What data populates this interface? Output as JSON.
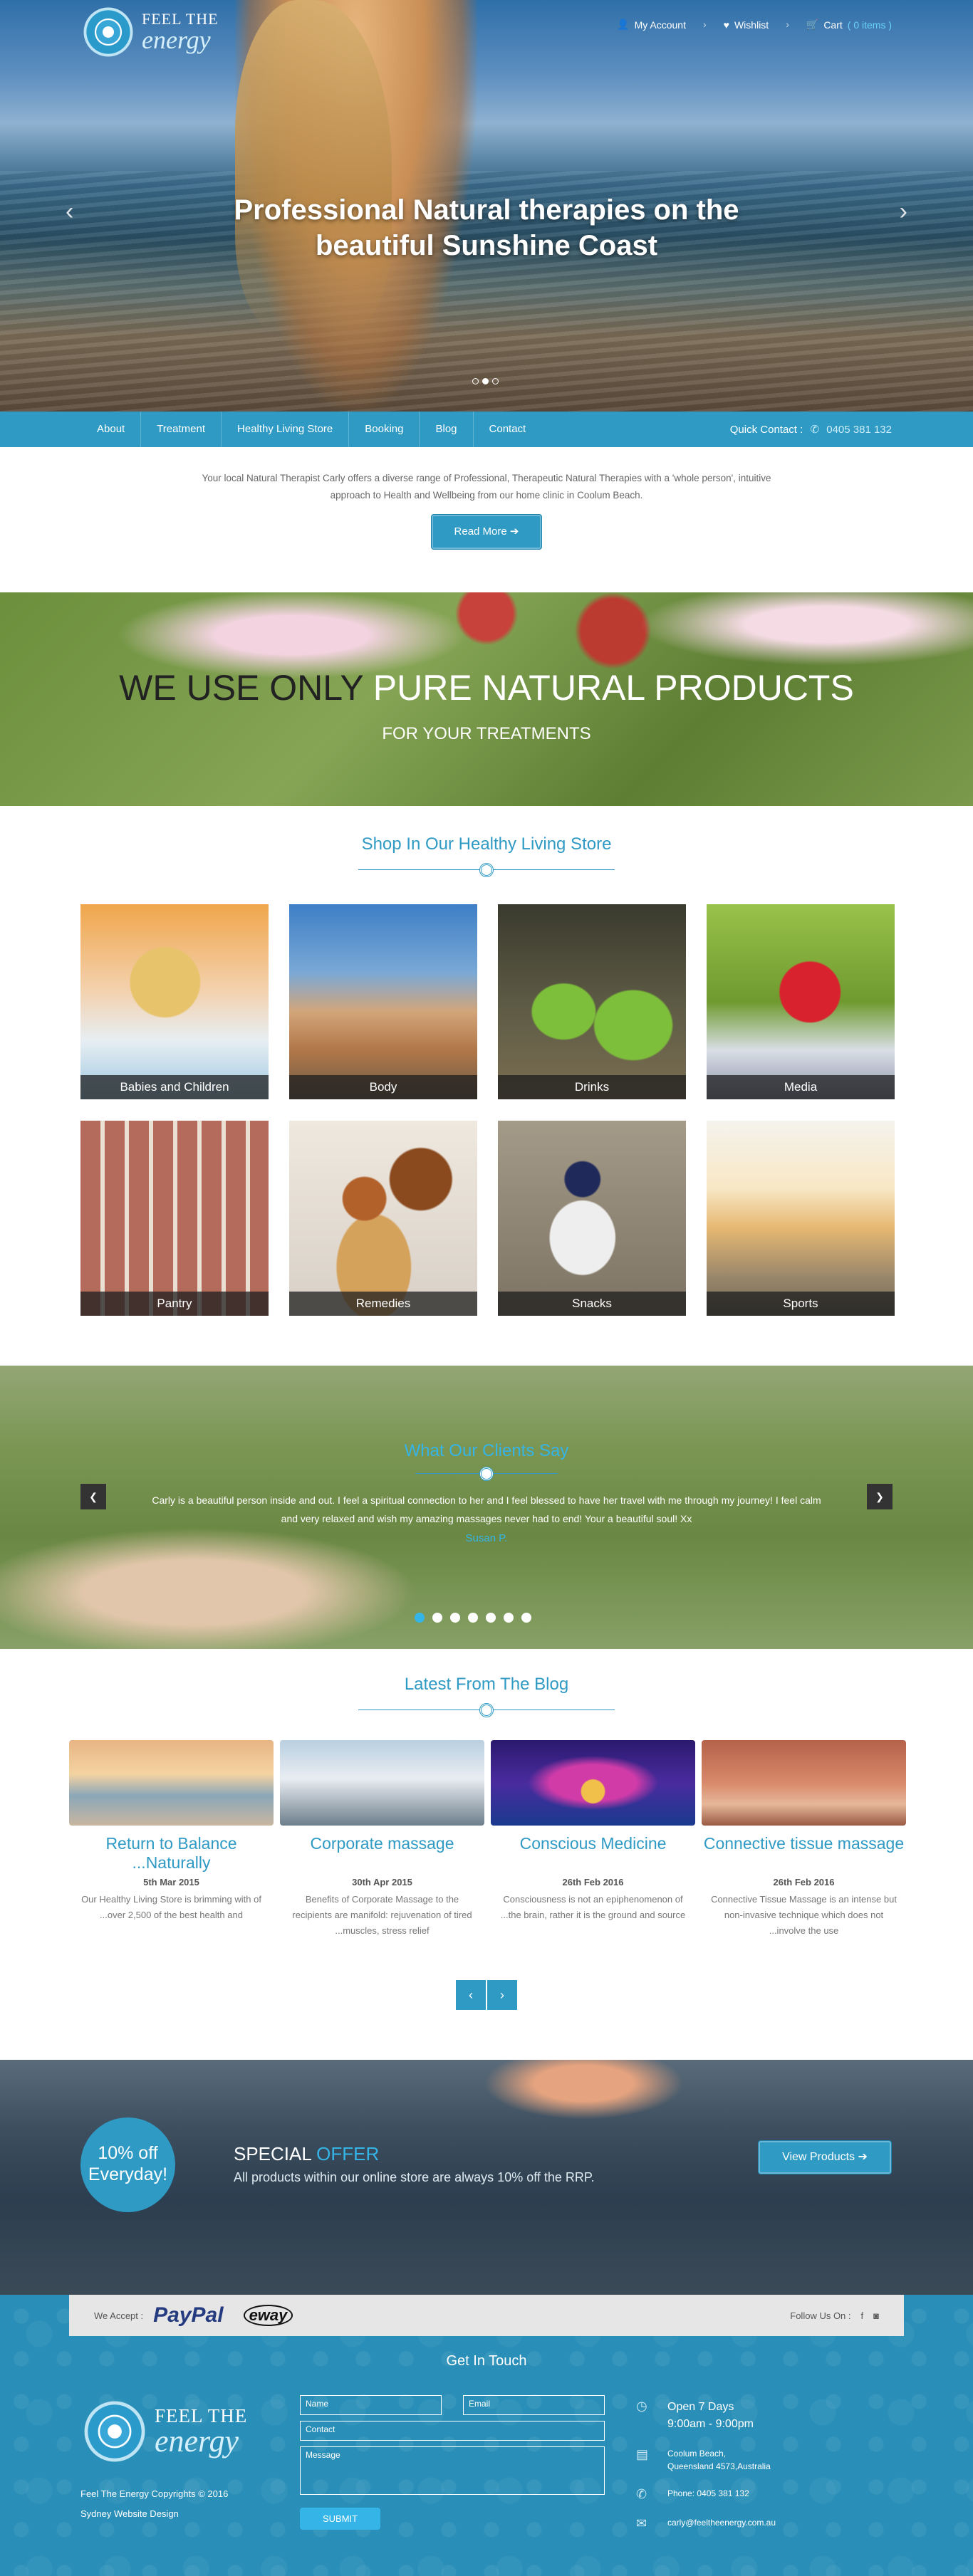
{
  "brand": {
    "line1": "FEEL THE",
    "line2": "energy"
  },
  "usernav": {
    "account": "My Account",
    "wishlist": "Wishlist",
    "cart": "Cart",
    "cart_count": "( 0 items )"
  },
  "hero": {
    "title": "Professional Natural therapies on the beautiful Sunshine Coast",
    "prev": "‹",
    "next": "›"
  },
  "nav": {
    "items": [
      "About",
      "Treatment",
      "Healthy Living Store",
      "Booking",
      "Blog",
      "Contact"
    ],
    "quick_label": "Quick Contact :",
    "quick_phone": "0405 381 132"
  },
  "intro": {
    "text": "Your local Natural Therapist Carly offers a diverse range of Professional, Therapeutic Natural Therapies with a 'whole person', intuitive approach to Health and Wellbeing from our home clinic in Coolum Beach.",
    "button": "Read More"
  },
  "natural": {
    "dark": "WE USE ONLY",
    "light": "PURE NATURAL PRODUCTS",
    "sub": "FOR YOUR TREATMENTS"
  },
  "store": {
    "heading": "Shop In Our Healthy Living Store",
    "categories": [
      "Babies and Children",
      "Body",
      "Drinks",
      "Media",
      "Pantry",
      "Remedies",
      "Snacks",
      "Sports"
    ]
  },
  "testimonials": {
    "heading": "What Our Clients Say",
    "quote": "Carly is a beautiful person inside and out. I feel a spiritual connection to her and I feel blessed to have her travel with me through my journey! I feel calm and very relaxed and wish my amazing massages never had to end! Your a beautiful soul! Xx",
    "author": "Susan P."
  },
  "blog": {
    "heading": "Latest From The Blog",
    "posts": [
      {
        "title": "Return to Balance ...Naturally",
        "date": "5th Mar 2015",
        "excerpt": "Our Healthy Living Store is brimming with of ...over 2,500 of the best health and"
      },
      {
        "title": "Corporate massage",
        "date": "30th Apr 2015",
        "excerpt": "Benefits of Corporate Massage to the recipients are manifold: rejuvenation of tired ...muscles, stress relief"
      },
      {
        "title": "Conscious Medicine",
        "date": "26th Feb 2016",
        "excerpt": "Consciousness is not an epiphenomenon of ...the brain, rather it is the ground and source"
      },
      {
        "title": "Connective tissue massage",
        "date": "26th Feb 2016",
        "excerpt": "Connective Tissue Massage is an intense but non-invasive technique which does not ...involve the use"
      }
    ]
  },
  "offer": {
    "badge1": "10% off",
    "badge2": "Everyday!",
    "title1": "SPECIAL",
    "title2": "OFFER",
    "sub": "All products within our online store are always 10% off the RRP.",
    "button": "View Products"
  },
  "footer": {
    "we_accept": "We Accept :",
    "paypal": "PayPal",
    "eway": "eway",
    "follow": "Follow Us On :",
    "get_in_touch": "Get In Touch",
    "copyright": "Feel The Energy Copyrights © 2016",
    "credit": "Sydney Website Design",
    "form": {
      "name": "Name",
      "email": "Email",
      "contact": "Contact",
      "message": "Message",
      "submit": "SUBMIT"
    },
    "hours1": "Open 7 Days",
    "hours2": "9:00am - 9:00pm",
    "addr1": "Coolum Beach,",
    "addr2": "Queensland 4573,Australia",
    "phone": "Phone: 0405 381 132",
    "email": "carly@feeltheenergy.com.au"
  },
  "colors": {
    "accent": "#2f9ac4",
    "accent_light": "#35b4e8"
  }
}
